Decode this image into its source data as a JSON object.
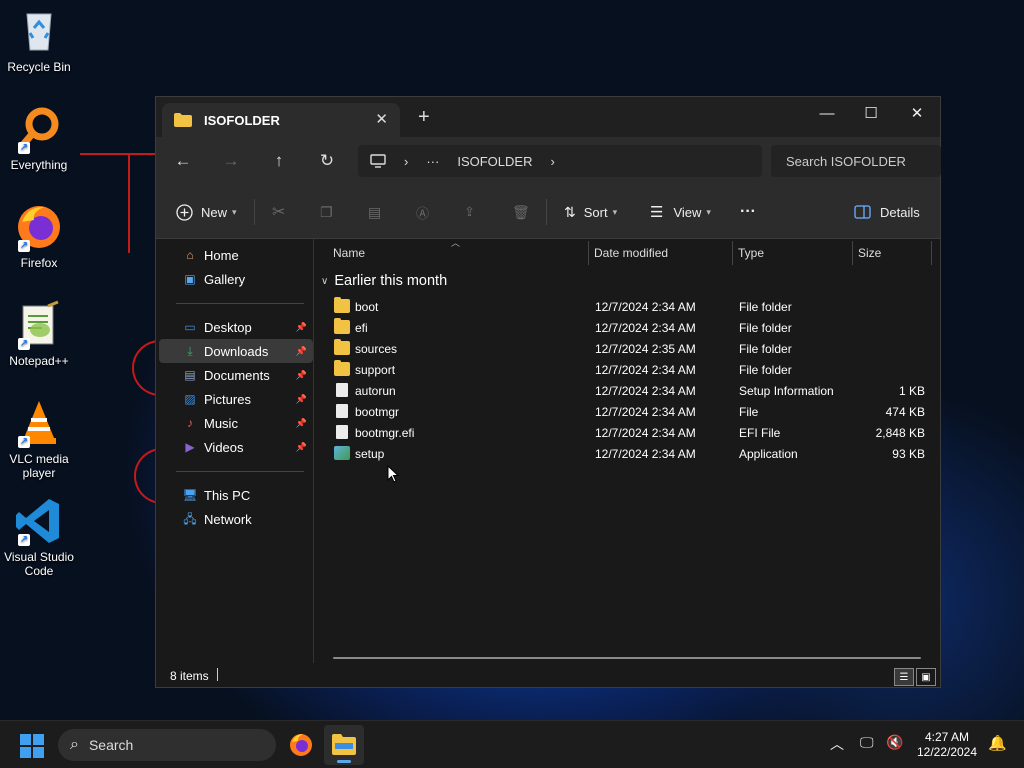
{
  "desktop": {
    "icons": [
      {
        "label": "Recycle Bin",
        "icon": "recycle-bin-icon"
      },
      {
        "label": "Everything",
        "icon": "everything-search-icon"
      },
      {
        "label": "Firefox",
        "icon": "firefox-icon"
      },
      {
        "label": "Notepad++",
        "icon": "notepad-plus-plus-icon"
      },
      {
        "label": "VLC media player",
        "icon": "vlc-icon"
      },
      {
        "label": "Visual Studio Code",
        "icon": "vscode-icon"
      }
    ]
  },
  "window": {
    "tab_title": "ISOFOLDER",
    "new_tab_symbol": "+",
    "controls": {
      "minimize": "—",
      "maximize": "☐",
      "close": "✕"
    },
    "address": {
      "ellipsis": "···",
      "crumb": "ISOFOLDER"
    },
    "search_placeholder": "Search ISOFOLDER",
    "toolbar": {
      "new_label": "New",
      "sort_label": "Sort",
      "view_label": "View",
      "more_label": "···",
      "details_label": "Details"
    },
    "nav": {
      "home": "Home",
      "gallery": "Gallery",
      "pinned": [
        {
          "label": "Desktop",
          "icon": "desktop-icon",
          "color": "#3a8ee6"
        },
        {
          "label": "Downloads",
          "icon": "download-icon",
          "color": "#2fb36a"
        },
        {
          "label": "Documents",
          "icon": "documents-icon",
          "color": "#8fa4c8"
        },
        {
          "label": "Pictures",
          "icon": "pictures-icon",
          "color": "#3f8fe0"
        },
        {
          "label": "Music",
          "icon": "music-icon",
          "color": "#e0605a"
        },
        {
          "label": "Videos",
          "icon": "videos-icon",
          "color": "#8a63d2"
        }
      ],
      "this_pc": "This PC",
      "network": "Network"
    },
    "columns": {
      "name": "Name",
      "date": "Date modified",
      "type": "Type",
      "size": "Size"
    },
    "group_label": "Earlier this month",
    "files": [
      {
        "name": "boot",
        "date": "12/7/2024 2:34 AM",
        "type": "File folder",
        "size": "",
        "kind": "folder"
      },
      {
        "name": "efi",
        "date": "12/7/2024 2:34 AM",
        "type": "File folder",
        "size": "",
        "kind": "folder"
      },
      {
        "name": "sources",
        "date": "12/7/2024 2:35 AM",
        "type": "File folder",
        "size": "",
        "kind": "folder"
      },
      {
        "name": "support",
        "date": "12/7/2024 2:34 AM",
        "type": "File folder",
        "size": "",
        "kind": "folder"
      },
      {
        "name": "autorun",
        "date": "12/7/2024 2:34 AM",
        "type": "Setup Information",
        "size": "1 KB",
        "kind": "file"
      },
      {
        "name": "bootmgr",
        "date": "12/7/2024 2:34 AM",
        "type": "File",
        "size": "474 KB",
        "kind": "file"
      },
      {
        "name": "bootmgr.efi",
        "date": "12/7/2024 2:34 AM",
        "type": "EFI File",
        "size": "2,848 KB",
        "kind": "file"
      },
      {
        "name": "setup",
        "date": "12/7/2024 2:34 AM",
        "type": "Application",
        "size": "93 KB",
        "kind": "app"
      }
    ],
    "status_items": "8 items"
  },
  "taskbar": {
    "search_label": "Search",
    "time": "4:27 AM",
    "date": "12/22/2024"
  }
}
